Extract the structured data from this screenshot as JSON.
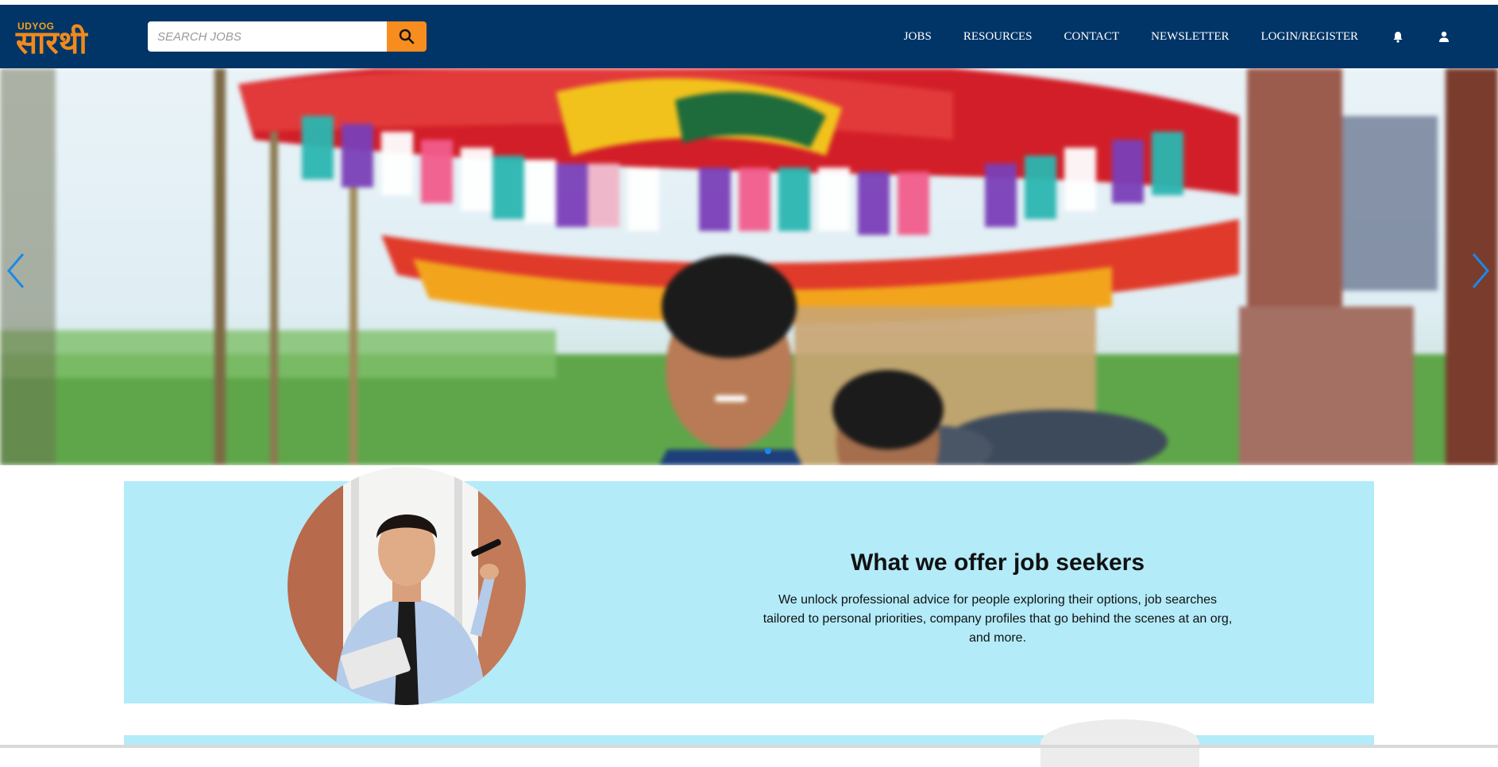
{
  "header": {
    "logo_small": "UDYOG",
    "logo_main": "सारथी",
    "search_placeholder": "SEARCH JOBS",
    "nav": [
      {
        "label": "JOBS"
      },
      {
        "label": "RESOURCES"
      },
      {
        "label": "CONTACT"
      },
      {
        "label": "NEWSLETTER"
      },
      {
        "label": "LOGIN/REGISTER"
      }
    ],
    "icons": [
      "bell-icon",
      "user-icon",
      "search-icon"
    ]
  },
  "hero": {
    "slides_visible": 1,
    "controls": [
      "chevron-left-icon",
      "chevron-right-icon"
    ]
  },
  "offer": {
    "title": "What we offer job seekers",
    "description": "We unlock professional advice for people exploring their options, job searches tailored to personal priorities, company profiles that go behind the scenes at an org, and more."
  },
  "colors": {
    "navbar": "#023567",
    "accent": "#f78d1e",
    "card": "#b3ebf9",
    "carousel_control": "#1e88e5"
  }
}
